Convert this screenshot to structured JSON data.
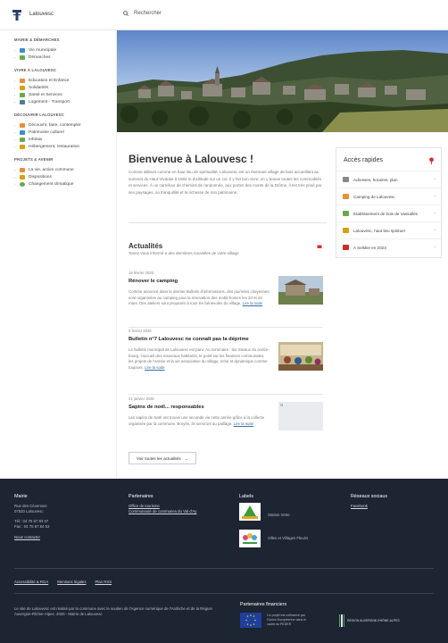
{
  "header": {
    "site_name": "Lalouvesc",
    "search_label": "Rechercher"
  },
  "sidebar": {
    "sections": [
      {
        "title": "Mairie & démarches",
        "items": [
          {
            "label": "Vie municipale",
            "color": "#3c8dcf"
          },
          {
            "label": "Démarches",
            "color": "#6aa84f"
          }
        ]
      },
      {
        "title": "Vivre à Lalouvesc",
        "items": [
          {
            "label": "Education et Enfance",
            "color": "#e69138"
          },
          {
            "label": "Solidarités",
            "color": "#d4a017"
          },
          {
            "label": "Santé et Services",
            "color": "#6aa84f"
          },
          {
            "label": "Logement - Transport",
            "color": "#45818e"
          }
        ]
      },
      {
        "title": "Découvrir Lalouvesc",
        "items": [
          {
            "label": "Découvrir, faire, contempler",
            "color": "#e69138"
          },
          {
            "label": "Patrimoine culturel",
            "color": "#3c8dcf"
          },
          {
            "label": "Infolaix",
            "color": "#6aa84f"
          },
          {
            "label": "Hébergement, restauration",
            "color": "#d4a017"
          }
        ]
      },
      {
        "title": "Projets & avenir",
        "items": [
          {
            "label": "La vie, action commune",
            "color": "#e69138"
          },
          {
            "label": "Dispositions",
            "color": "#d4a017"
          },
          {
            "label": "Changement climatique",
            "color": "#6aa84f"
          }
        ]
      }
    ]
  },
  "welcome": {
    "title": "Bienvenue à Lalouvesc !",
    "text": "Comme ailleurs comme en haut lieu de spiritualité, Lalouvesc est un étonnant village de bois accueillant au sommet du Haut-Vivarais à 1082 m d'altitude sur un col. Il y fait bon vivre, on y trouve toutes les commodités et services. À un carrefour de chemins de randonnée, aux portes des monts de la Drôme, il est très prisé par ses paysages, sa tranquillité et la richesse de son patrimoine."
  },
  "quick_access": {
    "title": "Accès rapides",
    "items": [
      {
        "label": "Adresses, horaires, plan",
        "color": "#888888"
      },
      {
        "label": "Camping de Lalouvesc",
        "color": "#e69138"
      },
      {
        "label": "Etablissement de bois de Vassalles",
        "color": "#6aa84f"
      },
      {
        "label": "Lalouvesc, haut lieu spirituel",
        "color": "#d4a017"
      },
      {
        "label": "A Selskie en 2023",
        "color": "#cc2a2a"
      }
    ]
  },
  "news": {
    "title": "Actualités",
    "subtitle": "Tenez-vous informé·e des dernières nouvelles de votre village",
    "articles": [
      {
        "date": "19 février 2026",
        "title": "Rénover le camping",
        "text": "Comme annoncé dans le dernier Bulletin d'informations, des journées citoyennes sont organisées au camping pour la rénovation des mobil-homes les 23 et 24 mars. Des ateliers sont proposés à tous les bénévoles du village.",
        "more": "Lire la suite"
      },
      {
        "date": "5 février 2026",
        "title": "Bulletin n°7 Lalouvesc ne connaît pas la déprime",
        "text": "Le bulletin municipal de Lalouvesc est paru. Au sommaire : les travaux du centre-bourg, l'accueil des nouveaux habitants, le point sur les finances communales, les projets de l'année et la vie associative du village, riche et dynamique comme toujours.",
        "more": "Lire la suite"
      },
      {
        "date": "21 janvier 2026",
        "title": "Sapins de noël... responsables",
        "text": "Les sapins de Noël ont trouvé une seconde vie cette année grâce à la collecte organisée par la commune. Broyés, ils serviront au paillage.",
        "more": "Lire la suite"
      }
    ],
    "all_label": "Voir toutes les actualités"
  },
  "footer": {
    "mairie": {
      "title": "Mairie",
      "lines": [
        "Rue des Cévennes",
        "07520 Lalouvesc"
      ],
      "phone": "Tél : 04 75 67 83 67",
      "fax": "Fax : 04 75 67 84 53",
      "contact": "Nous contacter"
    },
    "partners": {
      "title": "Partenaires",
      "links": [
        "Office de tourisme",
        "Communauté de communes du Val d'Ay"
      ]
    },
    "labels": {
      "title": "Labels",
      "items": [
        "Station Verte",
        "Villes et Villages Fleuris"
      ]
    },
    "social": {
      "title": "Réseaux sociaux",
      "links": [
        "Facebook"
      ]
    },
    "legal": [
      "Accessibilité & RGA",
      "Mentions légales",
      "Plan RSS"
    ],
    "bottom_text": "Le site de Lalouvesc est réalisé par la commune avec le soutien de l'Agence numérique de l'Ardèche et de la Région Auvergne-Rhône-Alpes. 2026 - Mairie de Lalouvesc",
    "financial": {
      "title": "Partenaires financiers",
      "eu_text": "Ce projet est cofinancé par l'Union Européenne dans le cadre du FEDER",
      "region": "RÉGION AUVERGNE-RHÔNE-ALPES"
    }
  }
}
